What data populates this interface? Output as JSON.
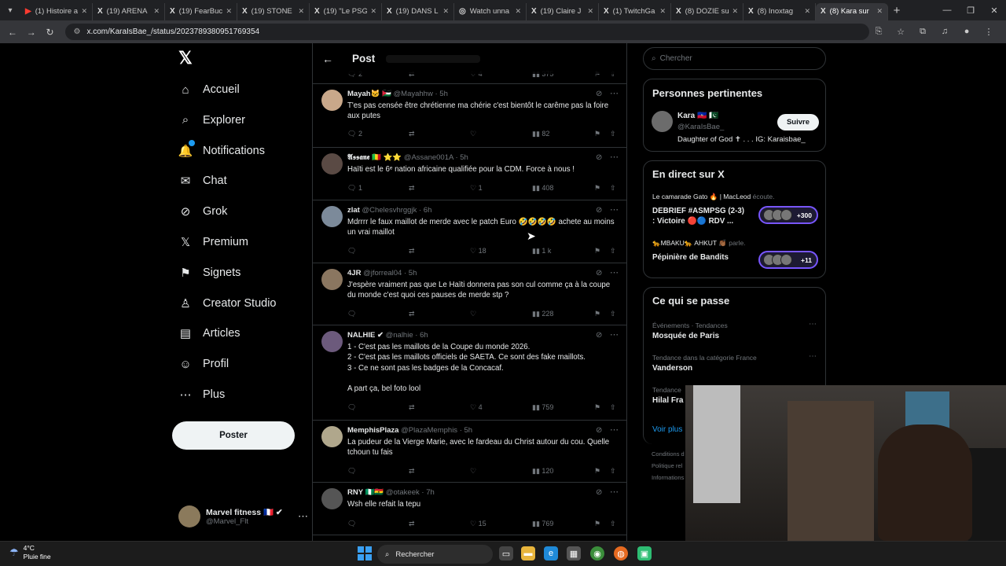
{
  "browser": {
    "tabs": [
      {
        "icon": "▶",
        "label": "(1) Histoire a"
      },
      {
        "icon": "X",
        "label": "(19) ARENA"
      },
      {
        "icon": "X",
        "label": "(19) FearBuc"
      },
      {
        "icon": "X",
        "label": "(19) STONE"
      },
      {
        "icon": "X",
        "label": "(19) \"Le PSG"
      },
      {
        "icon": "X",
        "label": "(19) DANS L"
      },
      {
        "icon": "◎",
        "label": "Watch unna"
      },
      {
        "icon": "X",
        "label": "(19) Claire J"
      },
      {
        "icon": "X",
        "label": "(1) TwitchGa"
      },
      {
        "icon": "X",
        "label": "(8) DOZIE su"
      },
      {
        "icon": "X",
        "label": "(8) Inoxtag"
      },
      {
        "icon": "X",
        "label": "(8) Kara sur"
      }
    ],
    "url": "x.com/KaraIsBae_/status/2023789380951769354"
  },
  "sidebar": {
    "items": [
      {
        "icon": "⌂",
        "label": "Accueil"
      },
      {
        "icon": "⌕",
        "label": "Explorer"
      },
      {
        "icon": "🔔",
        "label": "Notifications"
      },
      {
        "icon": "✉",
        "label": "Chat"
      },
      {
        "icon": "⊘",
        "label": "Grok"
      },
      {
        "icon": "𝕏",
        "label": "Premium"
      },
      {
        "icon": "⚑",
        "label": "Signets"
      },
      {
        "icon": "♙",
        "label": "Creator Studio"
      },
      {
        "icon": "▤",
        "label": "Articles"
      },
      {
        "icon": "☺",
        "label": "Profil"
      },
      {
        "icon": "⋯",
        "label": "Plus"
      }
    ],
    "post_button": "Poster",
    "account": {
      "name": "Marvel fitness 🇫🇷 ✔",
      "handle": "@Marvel_Flt"
    }
  },
  "feed": {
    "title": "Post",
    "top_stats": {
      "replies": "2",
      "likes": "4",
      "views": "375"
    },
    "tweets": [
      {
        "name": "Mayah🐱 🇯🇴",
        "handle": "@Mayahhw",
        "time": "5h",
        "text": "T'es pas censée être chrétienne ma chérie c'est bientôt le carême pas la foire aux putes",
        "replies": "2",
        "retweets": "",
        "likes": "",
        "views": "82",
        "avatar": "#c9a88a"
      },
      {
        "name": "𝕬𝖘𝖘𝖆𝖓𝖊 🇲🇱 ⭐⭐",
        "handle": "@Assane001A",
        "time": "5h",
        "text": "Haïti est le 6ᵉ nation africaine qualifiée pour la CDM. Force à nous !",
        "replies": "1",
        "retweets": "",
        "likes": "1",
        "views": "408",
        "avatar": "#5a4a44"
      },
      {
        "name": "zlat",
        "handle": "@Chelesvhrggjk",
        "time": "6h",
        "text": "Mdrrrr le faux maillot de merde avec le patch Euro 🤣🤣🤣🤣 achete au moins un vrai maillot",
        "replies": "",
        "retweets": "",
        "likes": "18",
        "views": "1 k",
        "avatar": "#7c8a9a"
      },
      {
        "name": "4JR",
        "handle": "@jforreal04",
        "time": "5h",
        "text": "J'espère vraiment pas que Le Haïti donnera pas son cul comme ça à la coupe du monde c'est quoi ces pauses de merde stp ?",
        "replies": "",
        "retweets": "",
        "likes": "",
        "views": "228",
        "avatar": "#8a7660"
      },
      {
        "name": "NALHIE ✔",
        "handle": "@nalhie",
        "time": "6h",
        "text": "1 - C'est pas les maillots de la Coupe du monde 2026.\n2 - C'est pas les maillots officiels de SAETA. Ce sont des fake maillots.\n3 - Ce ne sont pas les badges de la Concacaf.\n\nA part ça, bel foto lool",
        "replies": "",
        "retweets": "",
        "likes": "4",
        "views": "759",
        "avatar": "#6c5a7c"
      },
      {
        "name": "MemphisPlaza",
        "handle": "@PlazaMemphis",
        "time": "5h",
        "text": "La pudeur de la Vierge Marie, avec le fardeau du Christ autour du cou. Quelle tchoun tu fais",
        "replies": "",
        "retweets": "",
        "likes": "",
        "views": "120",
        "avatar": "#b0a78c"
      },
      {
        "name": "RNY 🇳🇬🇬🇭",
        "handle": "@otakeek",
        "time": "7h",
        "text": "Wsh elle refait la tepu",
        "replies": "",
        "retweets": "",
        "likes": "15",
        "views": "769",
        "avatar": "#555555"
      }
    ]
  },
  "right": {
    "search_placeholder": "Chercher",
    "relevant": {
      "title": "Personnes pertinentes",
      "name": "Kara 🇭🇹 🇵🇰",
      "handle": "@KaraIsBae_",
      "bio": "Daughter of God ✝ . . . IG: Karaisbae_",
      "follow": "Suivre"
    },
    "live": {
      "title": "En direct sur X",
      "spaces": [
        {
          "host": "Le camarade Gato 🔥 | MacLeod",
          "status": "écoute.",
          "title": "DEBRIEF #ASMPSG (2-3)\n: Victoire 🔴🔵 RDV ...",
          "count": "+300"
        },
        {
          "host": "🐆MBAKU🐆 AHKUT 👏🏾",
          "status": "parle.",
          "title": "Pépinière de Bandits",
          "count": "+11"
        }
      ]
    },
    "trends": {
      "title": "Ce qui se passe",
      "items": [
        {
          "meta": "Événements · Tendances",
          "name": "Mosquée de Paris"
        },
        {
          "meta": "Tendance dans la catégorie France",
          "name": "Vanderson"
        },
        {
          "meta": "Tendance",
          "name": "Hilal Fra"
        }
      ],
      "see_more": "Voir plus"
    },
    "footer": [
      "Conditions d",
      "Politique rel",
      "Informations"
    ]
  },
  "taskbar": {
    "temp": "4°C",
    "weather": "Pluie fine",
    "search": "Rechercher"
  }
}
